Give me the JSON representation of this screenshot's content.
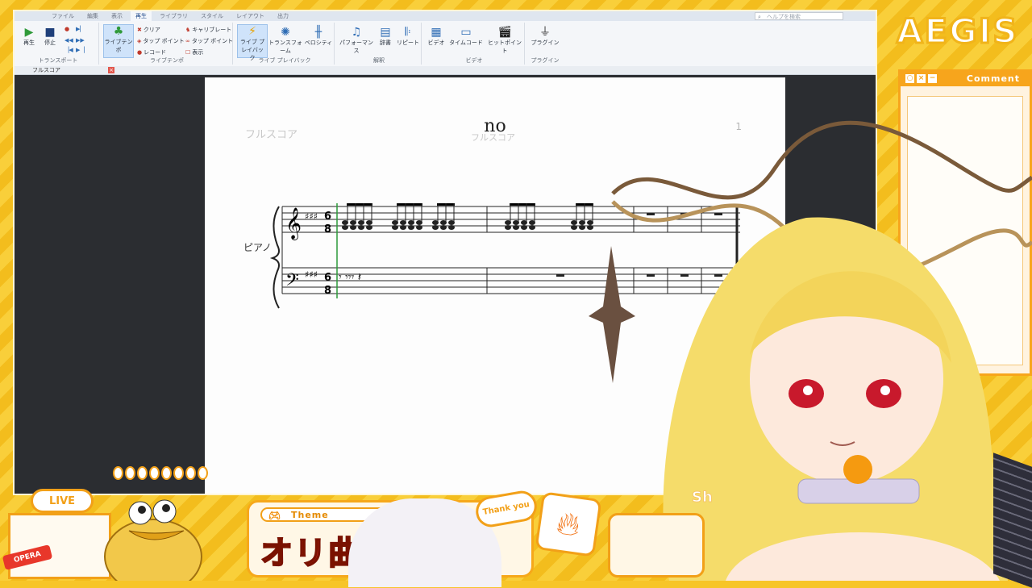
{
  "app": {
    "tabs": [
      "ファイル",
      "編集",
      "表示",
      "再生",
      "ライブラリ",
      "スタイル",
      "レイアウト",
      "出力"
    ],
    "active_tab": "再生",
    "search_placeholder": "ヘルプを検索",
    "ribbon": {
      "transport": {
        "label": "トランスポート",
        "play": "再生",
        "stop": "停止"
      },
      "live_tempo": {
        "label": "ライブテンポ",
        "button": "ライブテンポ",
        "small": [
          "クリア",
          "タップ ポイント",
          "レコード",
          "キャリブレート",
          "タップ ポイント",
          "表示"
        ]
      },
      "live_playback": {
        "label": "ライブ プレイバック",
        "buttons": [
          "ライブ プレイバック",
          "トランスフォーム",
          "ベロシティ"
        ]
      },
      "interpretation": {
        "label": "解釈",
        "buttons": [
          "パフォーマンス",
          "辞書",
          "リピート"
        ]
      },
      "video": {
        "label": "ビデオ",
        "buttons": [
          "ビデオ",
          "タイムコード",
          "ヒットポイント"
        ]
      },
      "plugin": {
        "label": "プラグイン",
        "buttons": [
          "プラグイン"
        ]
      }
    },
    "doc_tab": "フルスコア"
  },
  "score": {
    "title": "no",
    "header_left": "フルスコア",
    "header_center": "フルスコア",
    "page_number": "1",
    "instrument": "ピアノ",
    "time_signature": "6/8"
  },
  "overlay": {
    "logo": "AEGIS",
    "comment_title": "Comment",
    "live_badge": "LIVE",
    "opera_tag": "OPERA",
    "theme_label": "Theme",
    "theme_text": "オリ曲い",
    "thanks_text": "Thank you",
    "partial_text": "Sh"
  },
  "colors": {
    "accent": "#f2a018",
    "frame": "#f7c528",
    "red": "#e8232a"
  }
}
